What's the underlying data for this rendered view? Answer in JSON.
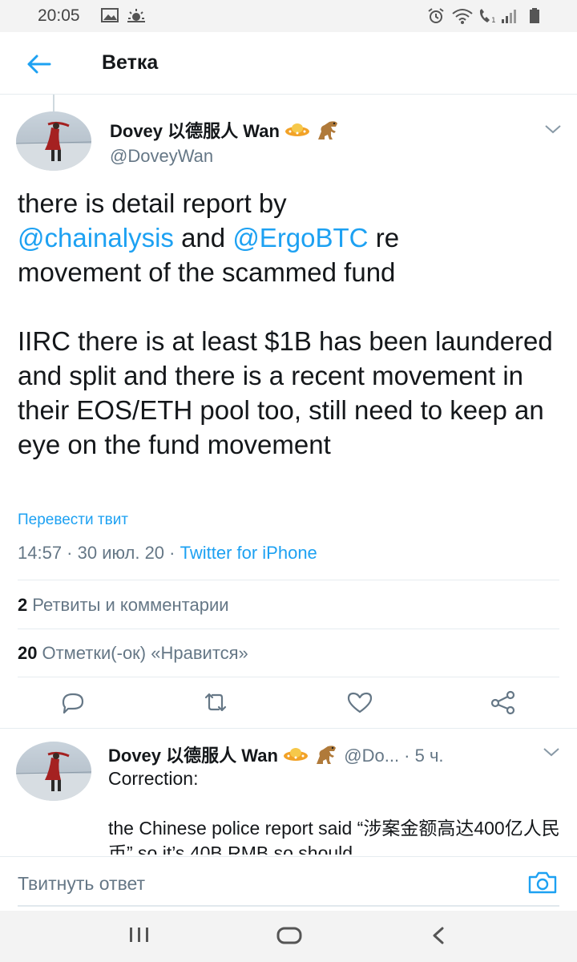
{
  "status_bar": {
    "time": "20:05",
    "icons_left": [
      "image-icon",
      "weather-icon"
    ],
    "icons_right": [
      "alarm-icon",
      "wifi-icon",
      "call-icon",
      "signal-icon",
      "battery-icon"
    ]
  },
  "header": {
    "back_icon": "arrow-left-icon",
    "title": "Ветка"
  },
  "main_tweet": {
    "author_name": "Dovey 以德服人 Wan",
    "author_emojis": [
      "ufo",
      "t-rex"
    ],
    "handle": "@DoveyWan",
    "text": {
      "line1_pre": "there is detail report by",
      "mention1": "@chainalysis",
      "and": " and ",
      "mention2": "@ErgoBTC",
      "re": " re",
      "line3": "movement of the scammed fund",
      "para2": "IIRC there is at least $1B has been laundered and split and there is a recent movement in their EOS/ETH pool too, still need to keep an eye on the fund movement"
    },
    "translate_label": "Перевести твит",
    "time": "14:57",
    "sep": " · ",
    "date": "30 июл. 20",
    "source": "Twitter for iPhone",
    "retweets_count": "2",
    "retweets_label": "Ретвиты и комментарии",
    "likes_count": "20",
    "likes_label": "Отметки(-ок) «Нравится»",
    "actions": [
      "reply-icon",
      "retweet-icon",
      "like-icon",
      "share-icon"
    ]
  },
  "reply_tweet": {
    "author_name": "Dovey 以德服人 Wan",
    "handle_truncated": "@Do...",
    "time_ago": " · 5 ч.",
    "line1": "Correction:",
    "para2": "the Chinese police report said “涉案金额高达400亿人民币” so it’s 40B RMB so should"
  },
  "composer": {
    "placeholder": "Твитнуть ответ",
    "camera_icon": "camera-icon"
  },
  "navbar": {
    "buttons": [
      "recents-icon",
      "home-icon",
      "back-icon"
    ]
  },
  "colors": {
    "accent": "#1da1f2",
    "text": "#14171a",
    "secondary": "#657786",
    "divider": "#e6ecf0"
  }
}
